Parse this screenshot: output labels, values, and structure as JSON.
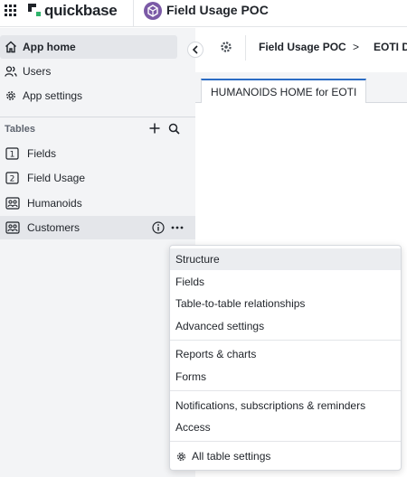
{
  "brand": {
    "name": "quickbase",
    "grid_icon": "apps-grid-icon",
    "logo_colors": [
      "#1f2329",
      "#2fb36b"
    ]
  },
  "app": {
    "title": "Field Usage POC",
    "badge_color": "#7b5aa6"
  },
  "sidebar": {
    "nav": [
      {
        "label": "App home",
        "icon": "home-icon",
        "active": true
      },
      {
        "label": "Users",
        "icon": "users-icon",
        "active": false
      },
      {
        "label": "App settings",
        "icon": "gear-icon",
        "active": false
      }
    ],
    "tables_header": "Tables",
    "tables": [
      {
        "label": "Fields",
        "icon": "table-number-icon",
        "badge": "1"
      },
      {
        "label": "Field Usage",
        "icon": "table-number-icon",
        "badge": "2"
      },
      {
        "label": "Humanoids",
        "icon": "people-table-icon",
        "badge": ""
      },
      {
        "label": "Customers",
        "icon": "people-table-icon",
        "badge": ""
      }
    ]
  },
  "breadcrumb": {
    "items": [
      "Field Usage POC",
      "EOTI D"
    ],
    "separator": ">"
  },
  "tabs": [
    {
      "label": "HUMANOIDS HOME for EOTI"
    }
  ],
  "context_menu": {
    "groups": [
      [
        "Structure",
        "Fields",
        "Table-to-table relationships",
        "Advanced settings"
      ],
      [
        "Reports & charts",
        "Forms"
      ],
      [
        "Notifications, subscriptions & reminders",
        "Access"
      ]
    ],
    "footer": {
      "label": "All table settings",
      "icon": "gear-icon"
    },
    "highlighted": "Structure"
  },
  "colors": {
    "accent": "#2b6cc4",
    "sidebar_bg": "#f3f4f6"
  }
}
